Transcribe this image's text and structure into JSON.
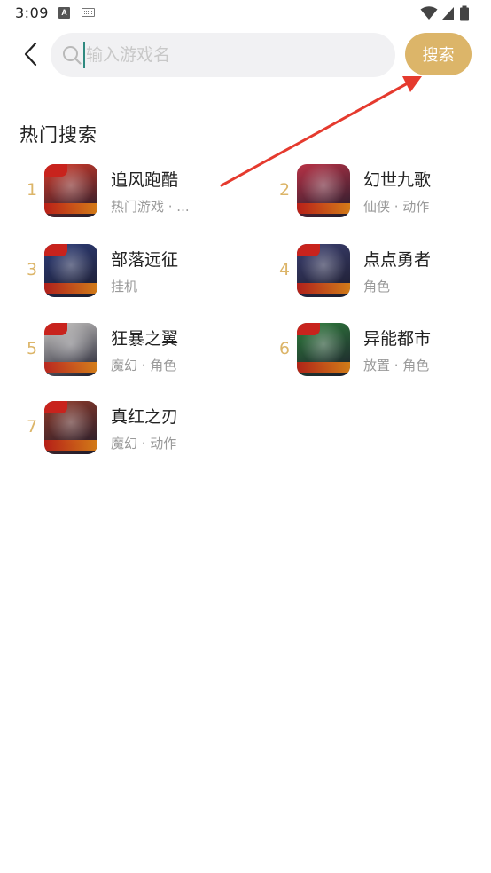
{
  "status_bar": {
    "time": "3:09",
    "notification_icon_letter": "A"
  },
  "search": {
    "placeholder": "输入游戏名",
    "value": "",
    "button_label": "搜索"
  },
  "hot_search": {
    "title": "热门搜索",
    "items": [
      {
        "rank": "1",
        "name": "追风跑酷",
        "tags": "热门游戏 · ...",
        "icon": "game-icon-zhuifeng",
        "color": "#d23a2a"
      },
      {
        "rank": "2",
        "name": "幻世九歌",
        "tags": "仙侠 · 动作",
        "icon": "game-icon-huanshi",
        "color": "#b83246"
      },
      {
        "rank": "3",
        "name": "部落远征",
        "tags": "挂机",
        "icon": "game-icon-buluo",
        "color": "#2d3c78"
      },
      {
        "rank": "4",
        "name": "点点勇者",
        "tags": "角色",
        "icon": "game-icon-diandian",
        "color": "#3b3f70"
      },
      {
        "rank": "5",
        "name": "狂暴之翼",
        "tags": "魔幻 · 角色",
        "icon": "game-icon-kuangbao",
        "color": "#c9c7c4"
      },
      {
        "rank": "6",
        "name": "异能都市",
        "tags": "放置 · 角色",
        "icon": "game-icon-yineng",
        "color": "#2f7d3c"
      },
      {
        "rank": "7",
        "name": "真红之刃",
        "tags": "魔幻 · 动作",
        "icon": "game-icon-zhenhong",
        "color": "#8f3a2a"
      }
    ]
  },
  "colors": {
    "accent": "#dcb569",
    "annotation_arrow": "#e53a2e"
  }
}
